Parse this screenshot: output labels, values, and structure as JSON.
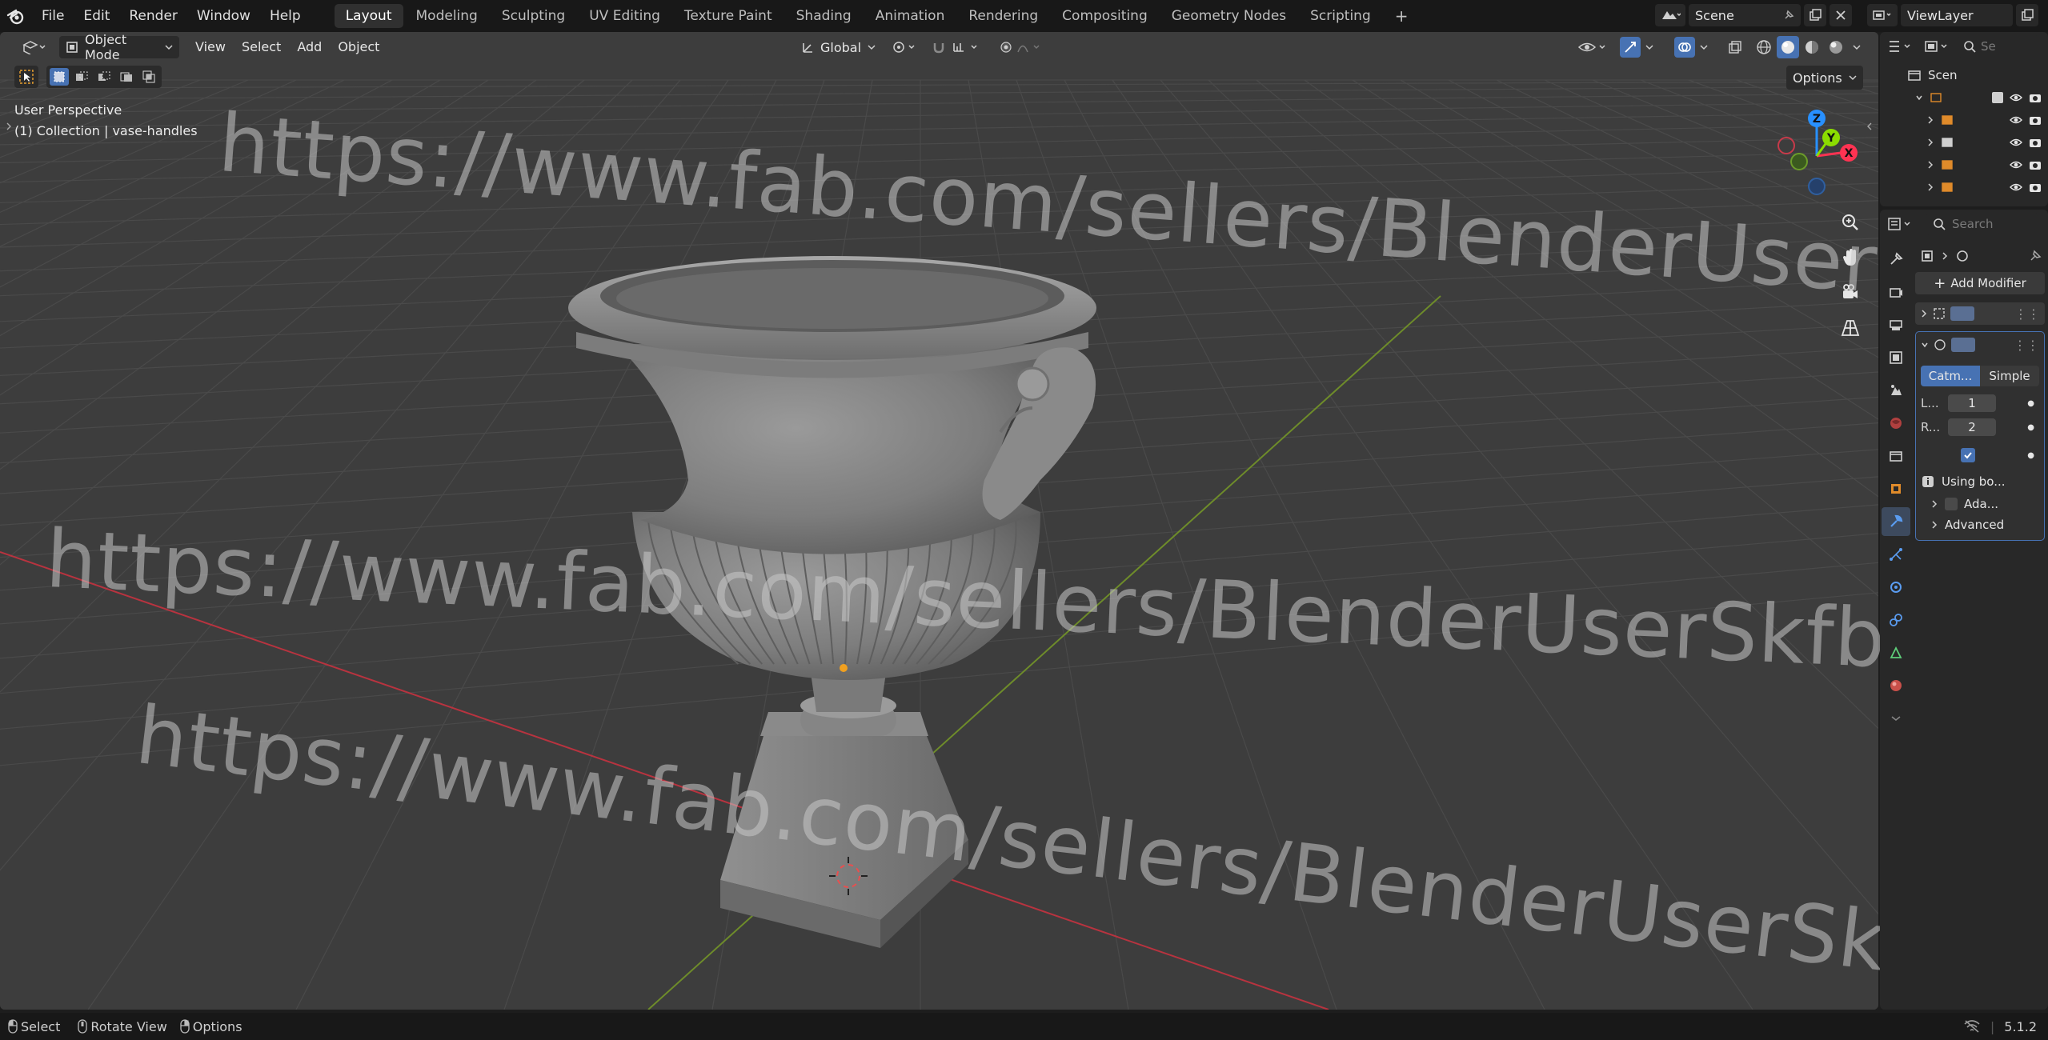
{
  "topbar": {
    "menus": [
      "File",
      "Edit",
      "Render",
      "Window",
      "Help"
    ],
    "workspaces": [
      "Layout",
      "Modeling",
      "Sculpting",
      "UV Editing",
      "Texture Paint",
      "Shading",
      "Animation",
      "Rendering",
      "Compositing",
      "Geometry Nodes",
      "Scripting"
    ],
    "active_workspace": "Layout",
    "add_workspace": "+",
    "scene_name": "Scene",
    "view_layer": "ViewLayer"
  },
  "viewport_header": {
    "mode": "Object Mode",
    "menus": [
      "View",
      "Select",
      "Add",
      "Object"
    ],
    "transform_orientation": "Global",
    "options_label": "Options"
  },
  "viewport_overlay": {
    "perspective": "User Perspective",
    "collection_info": "(1) Collection | vase-handles",
    "gizmo_axes": [
      "Z",
      "Y",
      "X"
    ]
  },
  "watermark": {
    "text": "https://www.fab.com/sellers/BlenderUserSkfb"
  },
  "outliner": {
    "scene_label": "Scen",
    "search_placeholder": "Se"
  },
  "properties": {
    "search_placeholder": "Search",
    "add_modifier": "Add Modifier",
    "subdiv_catmull": "Catm...",
    "subdiv_simple": "Simple",
    "levels_label": "L...",
    "levels_value": "1",
    "render_label": "R...",
    "render_value": "2",
    "info_text": "Using bo...",
    "adaptive_label": "Ada...",
    "advanced_label": "Advanced"
  },
  "statusbar": {
    "select": "Select",
    "rotate_view": "Rotate View",
    "options": "Options",
    "version": "5.1.2"
  },
  "colors": {
    "viewport_bg": "#3d3d3d",
    "accent_blue": "#4772b3",
    "axis_x": "#ff3352",
    "axis_y": "#8bdc00",
    "axis_z": "#2890ff"
  }
}
